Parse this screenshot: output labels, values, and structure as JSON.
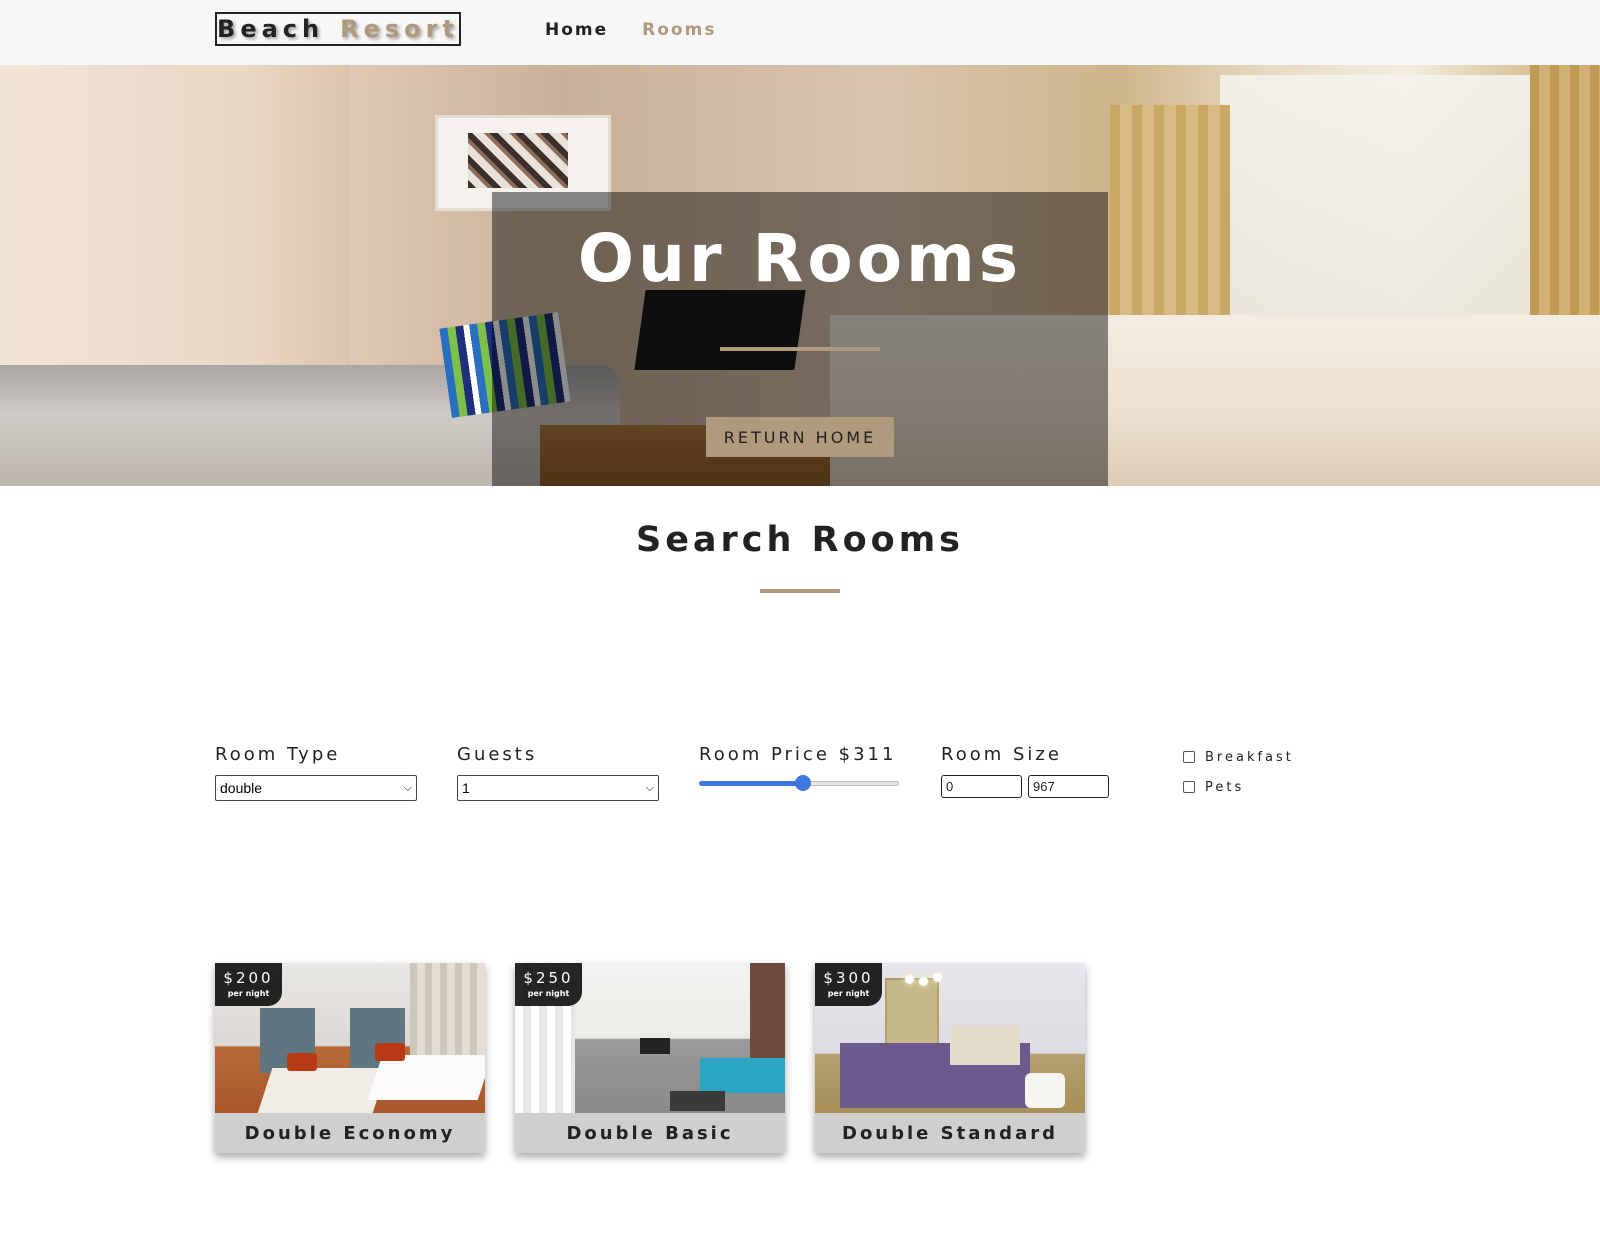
{
  "navbar": {
    "logo": {
      "word1": "Beach",
      "word2": "Resort"
    },
    "links": [
      {
        "label": "Home",
        "active": false
      },
      {
        "label": "Rooms",
        "active": true
      }
    ]
  },
  "hero": {
    "title": "Our Rooms",
    "button_label": "return home"
  },
  "search": {
    "title": "Search Rooms",
    "filters": {
      "room_type": {
        "label": "Room Type",
        "value": "double"
      },
      "guests": {
        "label": "Guests",
        "value": "1"
      },
      "price": {
        "label": "Room Price $311",
        "slider_fraction": 0.52
      },
      "size": {
        "label": "Room Size",
        "min": "0",
        "max": "967"
      },
      "extras": [
        {
          "label": "Breakfast",
          "checked": false
        },
        {
          "label": "Pets",
          "checked": false
        }
      ]
    }
  },
  "rooms": [
    {
      "price": "$200",
      "per": "per night",
      "name": "Double Economy"
    },
    {
      "price": "$250",
      "per": "per night",
      "name": "Double Basic"
    },
    {
      "price": "$300",
      "per": "per night",
      "name": "Double Standard"
    }
  ],
  "colors": {
    "accent": "#af9a7d",
    "navbar_bg": "#f7f7f7",
    "slider": "#3d78e0",
    "card_title_bg": "#cfcfcf"
  },
  "icons": {
    "select_chevron": "chevron-down-icon",
    "checkbox": "checkbox-icon"
  }
}
